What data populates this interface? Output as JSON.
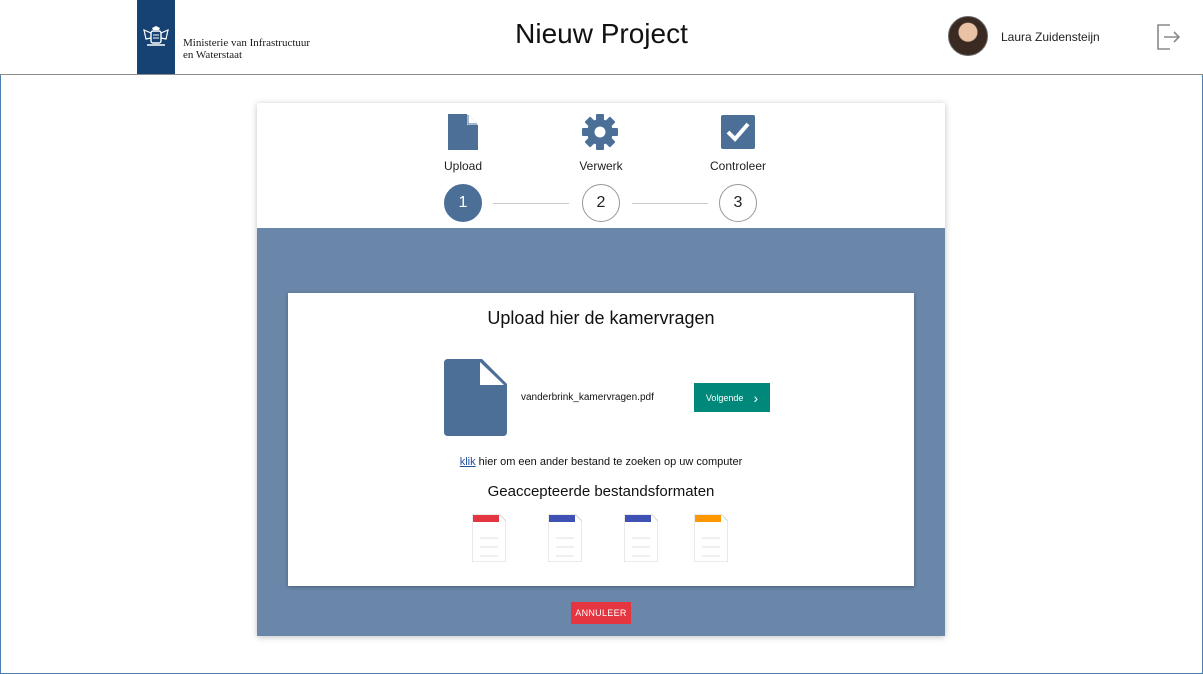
{
  "header": {
    "org_name_line1": "Ministerie van Infrastructuur",
    "org_name_line2": "en Waterstaat",
    "title": "Nieuw Project",
    "user_name": "Laura Zuidensteijn"
  },
  "steps": [
    {
      "label": "Upload",
      "number": "1",
      "icon": "file-icon",
      "active": true
    },
    {
      "label": "Verwerk",
      "number": "2",
      "icon": "gear-icon",
      "active": false
    },
    {
      "label": "Controleer",
      "number": "3",
      "icon": "checkbox-icon",
      "active": false
    }
  ],
  "upload": {
    "title": "Upload hier de kamervragen",
    "file_name": "vanderbrink_kamervragen.pdf",
    "next_label": "Volgende",
    "hint_link": "klik",
    "hint_text": " hier om een ander bestand te zoeken op uw computer",
    "formats_title": "Geaccepteerde bestandsformaten",
    "formats": [
      {
        "name": "pdf",
        "color": "#e53541"
      },
      {
        "name": "doc",
        "color": "#3f51b5"
      },
      {
        "name": "docx",
        "color": "#3f51b5"
      },
      {
        "name": "other",
        "color": "#ff9800"
      }
    ]
  },
  "cancel_label": "ANNULEER",
  "colors": {
    "brand_blue": "#154273",
    "step_active": "#4c6f98",
    "panel_bg": "#6a87a9",
    "next_button": "#00897b",
    "cancel_button": "#e53541"
  }
}
